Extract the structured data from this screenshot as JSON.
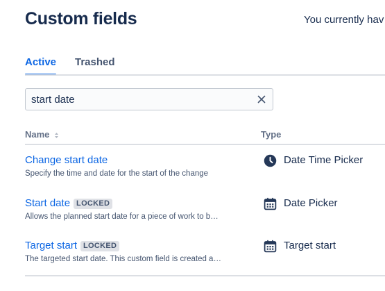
{
  "page": {
    "title": "Custom fields",
    "header_note": "You currently hav"
  },
  "tabs": [
    {
      "label": "Active",
      "selected": true
    },
    {
      "label": "Trashed",
      "selected": false
    }
  ],
  "search": {
    "value": "start date"
  },
  "table": {
    "columns": {
      "name": "Name",
      "type": "Type"
    },
    "rows": [
      {
        "name": "Change start date",
        "locked": "",
        "description": "Specify the time and date for the start of the change",
        "type": "Date Time Picker",
        "type_icon": "clock-icon"
      },
      {
        "name": "Start date",
        "locked": "LOCKED",
        "description": "Allows the planned start date for a piece of work to b…",
        "type": "Date Picker",
        "type_icon": "calendar-icon"
      },
      {
        "name": "Target start",
        "locked": "LOCKED",
        "description": "The targeted start date. This custom field is created a…",
        "type": "Target start",
        "type_icon": "calendar-icon"
      }
    ]
  },
  "colors": {
    "link": "#0c66e4",
    "text": "#172b4d",
    "subtle_text": "#44546f",
    "lozenge_bg": "#dfe1e6",
    "divider": "#dcdfe4"
  }
}
